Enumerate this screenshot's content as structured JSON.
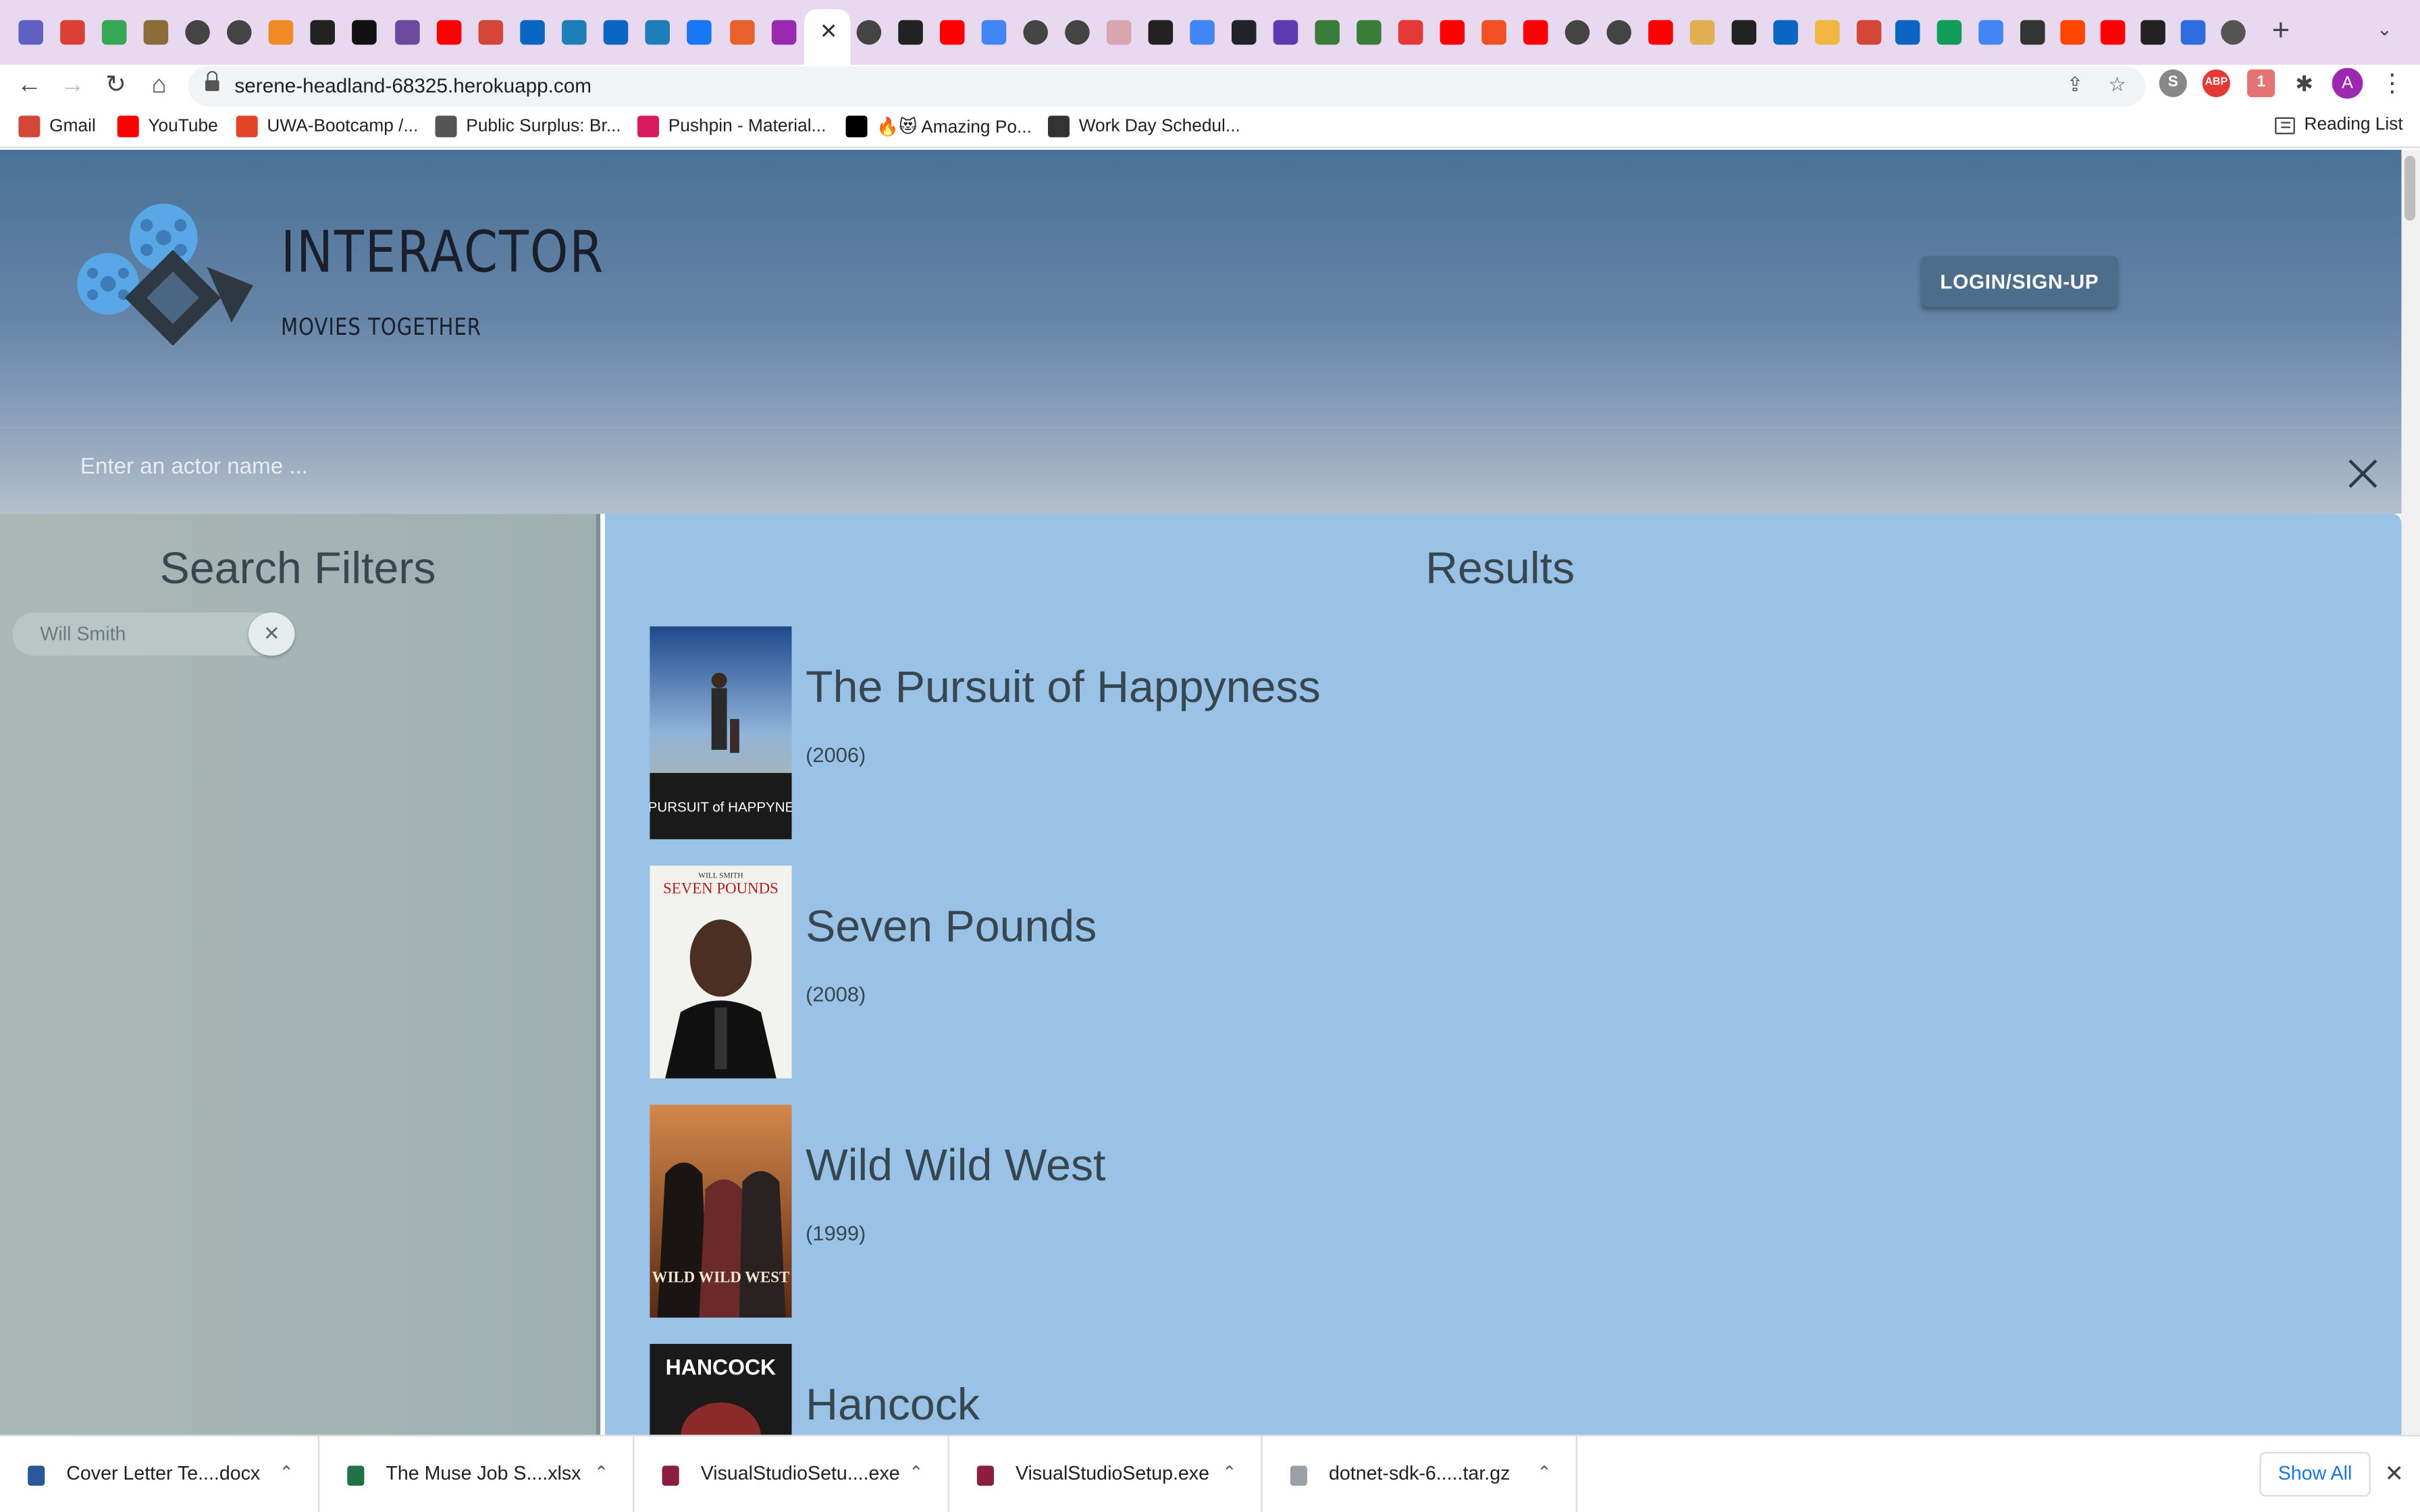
{
  "browser": {
    "url": "serene-headland-68325.herokuapp.com",
    "tab_icons": [
      {
        "name": "tasks-icon",
        "color": "#5f5fc4"
      },
      {
        "name": "todoist-icon",
        "color": "#db4035"
      },
      {
        "name": "google-drive-icon",
        "color": "#34a853"
      },
      {
        "name": "figure-icon",
        "color": "#8a6d3b"
      },
      {
        "name": "globe-icon",
        "color": "#444"
      },
      {
        "name": "globe-icon",
        "color": "#444"
      },
      {
        "name": "box-icon",
        "color": "#f08a24"
      },
      {
        "name": "dark-icon",
        "color": "#222"
      },
      {
        "name": "hn-icon",
        "color": "#111"
      },
      {
        "name": "w-icon",
        "color": "#6a4a9c"
      },
      {
        "name": "youtube-icon",
        "color": "#ff0000"
      },
      {
        "name": "gmail-icon",
        "color": "#d44638"
      },
      {
        "name": "linkedin-icon",
        "color": "#0a66c2"
      },
      {
        "name": "play-icon",
        "color": "#1d7fb8"
      },
      {
        "name": "linkedin-icon",
        "color": "#0a66c2"
      },
      {
        "name": "play-icon",
        "color": "#1d7fb8"
      },
      {
        "name": "f-icon",
        "color": "#1877f2"
      },
      {
        "name": "r-icon",
        "color": "#e8632b"
      },
      {
        "name": "purple-icon",
        "color": "#9c27b0"
      },
      {
        "name": "globe-icon",
        "color": "#444"
      },
      {
        "name": "amazon-icon",
        "color": "#222"
      },
      {
        "name": "youtube-icon",
        "color": "#ff0000"
      },
      {
        "name": "google-icon",
        "color": "#4285f4"
      },
      {
        "name": "globe-icon",
        "color": "#444"
      },
      {
        "name": "globe-icon",
        "color": "#444"
      },
      {
        "name": "swirl-icon",
        "color": "#d9a6b0"
      },
      {
        "name": "github-icon",
        "color": "#222"
      },
      {
        "name": "google-icon",
        "color": "#4285f4"
      },
      {
        "name": "react-icon",
        "color": "#20232a"
      },
      {
        "name": "a-icon",
        "color": "#5c3bb0"
      },
      {
        "name": "w-icon",
        "color": "#3a7d3a"
      },
      {
        "name": "w-icon",
        "color": "#3a7d3a"
      },
      {
        "name": "star-icon",
        "color": "#e53935"
      },
      {
        "name": "youtube-icon",
        "color": "#ff0000"
      },
      {
        "name": "microsoft-icon",
        "color": "#f25022"
      },
      {
        "name": "youtube-icon",
        "color": "#ff0000"
      },
      {
        "name": "globe-icon",
        "color": "#444"
      },
      {
        "name": "globe-icon",
        "color": "#444"
      },
      {
        "name": "youtube-icon",
        "color": "#ff0000"
      },
      {
        "name": "cube-icon",
        "color": "#e0b050"
      },
      {
        "name": "p-icon",
        "color": "#222"
      },
      {
        "name": "linkedin-icon",
        "color": "#0a66c2"
      },
      {
        "name": "cube-icon",
        "color": "#f0b840"
      },
      {
        "name": "gmail-icon",
        "color": "#d44638"
      },
      {
        "name": "linkedin-icon",
        "color": "#0a66c2"
      },
      {
        "name": "plus-icon",
        "color": "#0f9d58"
      },
      {
        "name": "docs-icon",
        "color": "#4285f4"
      },
      {
        "name": "jira-icon",
        "color": "#333"
      },
      {
        "name": "reddit-icon",
        "color": "#ff4500"
      },
      {
        "name": "youtube-icon",
        "color": "#ff0000"
      },
      {
        "name": "github-icon",
        "color": "#222"
      },
      {
        "name": "z-icon",
        "color": "#2d6cdf"
      },
      {
        "name": "chrome-icon",
        "color": "#555"
      }
    ],
    "extension_badge": "1",
    "avatar_letter": "A",
    "bookmarks": [
      {
        "label": "Gmail",
        "icon": "gmail-icon",
        "color": "#d44638"
      },
      {
        "label": "YouTube",
        "icon": "youtube-icon",
        "color": "#ff0000"
      },
      {
        "label": "UWA-Bootcamp /...",
        "icon": "gitlab-icon",
        "color": "#e24329"
      },
      {
        "label": "Public Surplus: Br...",
        "icon": "ps-icon",
        "color": "#555"
      },
      {
        "label": "Pushpin - Material...",
        "icon": "pushpin-icon",
        "color": "#d81b60"
      },
      {
        "label": "🔥😻 Amazing Po...",
        "icon": "dev-icon",
        "color": "#000000"
      },
      {
        "label": "Work Day Schedul...",
        "icon": "globe-icon",
        "color": "#333"
      }
    ],
    "reading_list": "Reading List"
  },
  "app": {
    "logo_title": "INTERACTOR",
    "logo_subtitle": "MOVIES TOGETHER",
    "login_label": "LOGIN/SIGN-UP",
    "search_placeholder": "Enter an actor name ...",
    "filters_title": "Search Filters",
    "active_filter": "Will Smith",
    "results_title": "Results",
    "results": [
      {
        "title": "The Pursuit of Happyness",
        "year": "(2006)",
        "poster_text": "thePURSUIT of HAPPYNESS"
      },
      {
        "title": "Seven Pounds",
        "year": "(2008)",
        "poster_text": "SEVEN POUNDS",
        "poster_top": "WILL SMITH"
      },
      {
        "title": "Wild Wild West",
        "year": "(1999)",
        "poster_text": "WILD WILD WEST"
      },
      {
        "title": "Hancock",
        "year": "",
        "poster_text": "HANCOCK"
      }
    ]
  },
  "downloads": [
    {
      "name": "Cover Letter Te....docx",
      "color": "#2b579a"
    },
    {
      "name": "The Muse Job S....xlsx",
      "color": "#217346"
    },
    {
      "name": "VisualStudioSetu....exe",
      "color": "#8b1e3f"
    },
    {
      "name": "VisualStudioSetup.exe",
      "color": "#8b1e3f"
    },
    {
      "name": "dotnet-sdk-6.....tar.gz",
      "color": "#9aa0a6"
    }
  ],
  "show_all_label": "Show All"
}
